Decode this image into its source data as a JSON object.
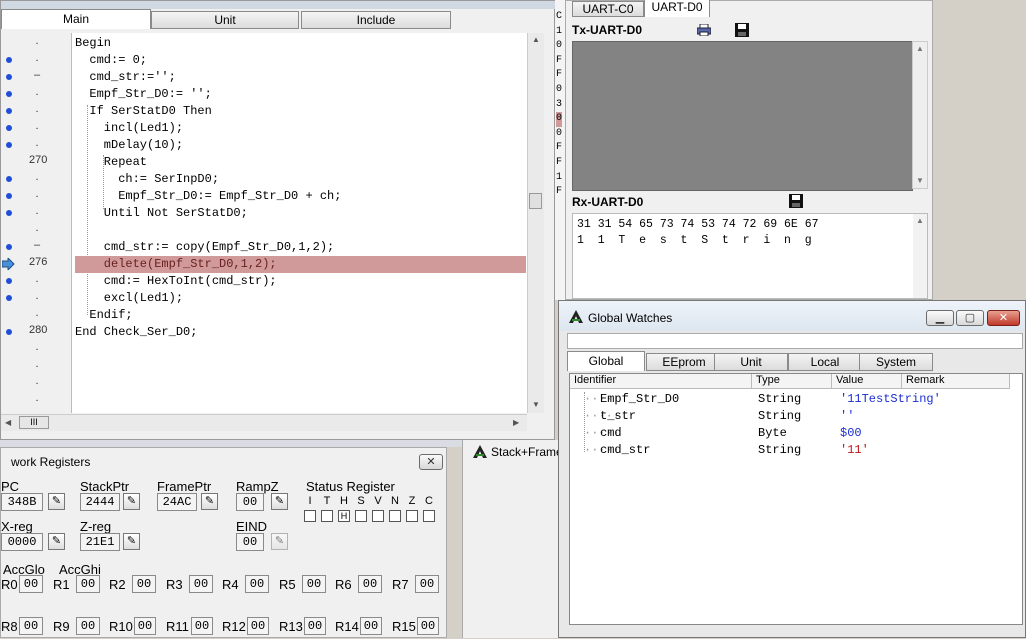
{
  "editor": {
    "tabs": [
      "Main",
      "Unit",
      "Include"
    ],
    "active_tab": "Main",
    "line_numbers": [
      "270",
      "276",
      "280"
    ],
    "code": [
      "Begin",
      "  cmd:= 0;",
      "  cmd_str:='';",
      "  Empf_Str_D0:= '';",
      "  If SerStatD0 Then",
      "    incl(Led1);",
      "    mDelay(10);",
      "    Repeat",
      "      ch:= SerInpD0;",
      "      Empf_Str_D0:= Empf_Str_D0 + ch;",
      "    Until Not SerStatD0;",
      "",
      "    cmd_str:= copy(Empf_Str_D0,1,2);",
      "    delete(Empf_Str_D0,1,2);",
      "    cmd:= HexToInt(cmd_str);",
      "    excl(Led1);",
      "  Endif;",
      "End Check_Ser_D0;"
    ],
    "hscroll_label": "III"
  },
  "side_column": [
    "C",
    "1",
    "0",
    "F",
    "F",
    "0",
    "3",
    "0",
    "0",
    "F",
    "F",
    "1",
    "F"
  ],
  "registers": {
    "title": "work Registers",
    "pc_label": "PC",
    "pc": "348B",
    "stackptr_label": "StackPtr",
    "stackptr": "2444",
    "frameptr_label": "FramePtr",
    "frameptr": "24AC",
    "rampz_label": "RampZ",
    "rampz": "00",
    "status_label": "Status Register",
    "flags": [
      "I",
      "T",
      "H",
      "S",
      "V",
      "N",
      "Z",
      "C"
    ],
    "flag_values": [
      "",
      "",
      "H",
      "",
      "",
      "",
      "",
      ""
    ],
    "xreg_label": "X-reg",
    "xreg": "0000",
    "zreg_label": "Z-reg",
    "zreg": "21E1",
    "eind_label": "EIND",
    "eind": "00",
    "accglo_label": "AccGlo",
    "accghi_label": "AccGhi",
    "row1": [
      [
        "R0",
        "00"
      ],
      [
        "R1",
        "00"
      ],
      [
        "R2",
        "00"
      ],
      [
        "R3",
        "00"
      ],
      [
        "R4",
        "00"
      ],
      [
        "R5",
        "00"
      ],
      [
        "R6",
        "00"
      ],
      [
        "R7",
        "00"
      ]
    ],
    "row2": [
      [
        "R8",
        "00"
      ],
      [
        "R9",
        "00"
      ],
      [
        "R10",
        "00"
      ],
      [
        "R11",
        "00"
      ],
      [
        "R12",
        "00"
      ],
      [
        "R13",
        "00"
      ],
      [
        "R14",
        "00"
      ],
      [
        "R15",
        "00"
      ]
    ]
  },
  "stack_tab": "Stack+Frame",
  "uart": {
    "tabs": [
      "UART-C0",
      "UART-D0"
    ],
    "active_tab": "UART-D0",
    "tx_label": "Tx-UART-D0",
    "rx_label": "Rx-UART-D0",
    "rx_hex": "31 31 54 65 73 74 53 74 72 69 6E 67",
    "rx_ascii": "1  1  T  e  s  t  S  t  r  i  n  g"
  },
  "watches": {
    "title": "Global Watches",
    "tabs": [
      "Global",
      "EEprom",
      "Unit",
      "Local",
      "System"
    ],
    "active_tab": "Global",
    "columns": [
      "Identifier",
      "Type",
      "Value",
      "Remark"
    ],
    "rows": [
      {
        "id": "Empf_Str_D0",
        "type": "String",
        "value": "'11TestString'"
      },
      {
        "id": "t_str",
        "type": "String",
        "value": "''"
      },
      {
        "id": "cmd",
        "type": "Byte",
        "value": "$00"
      },
      {
        "id": "cmd_str",
        "type": "String",
        "value": "'11'"
      }
    ],
    "colors": {
      "value": "#1a2fd0",
      "string_value": "#c0161b"
    }
  }
}
